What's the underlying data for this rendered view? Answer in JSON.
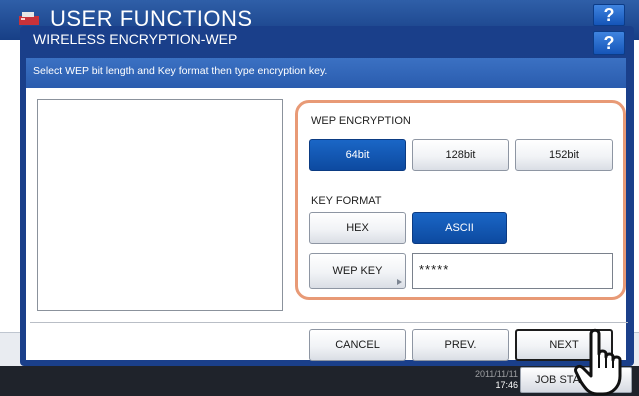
{
  "background_screen": {
    "title": "USER FUNCTIONS",
    "help_label": "?",
    "clock_line1": "2011/11/11",
    "clock_line2": "17:46",
    "job_status_label": "JOB STATUS"
  },
  "dialog": {
    "title": "WIRELESS ENCRYPTION-WEP",
    "help_label": "?",
    "instruction": "Select WEP bit length and Key format then type encryption key."
  },
  "wep_encryption": {
    "label": "WEP ENCRYPTION",
    "options": [
      "64bit",
      "128bit",
      "152bit"
    ],
    "selected": "64bit"
  },
  "key_format": {
    "label": "KEY FORMAT",
    "options": [
      "HEX",
      "ASCII"
    ],
    "selected": "ASCII"
  },
  "wep_key": {
    "button_label": "WEP KEY",
    "value": "*****"
  },
  "footer": {
    "cancel_label": "CANCEL",
    "prev_label": "PREV.",
    "next_label": "NEXT"
  },
  "colors": {
    "frame_blue": "#1a3f8a",
    "selected_blue": "#0d4aa0",
    "highlight_orange": "#e89a76"
  }
}
